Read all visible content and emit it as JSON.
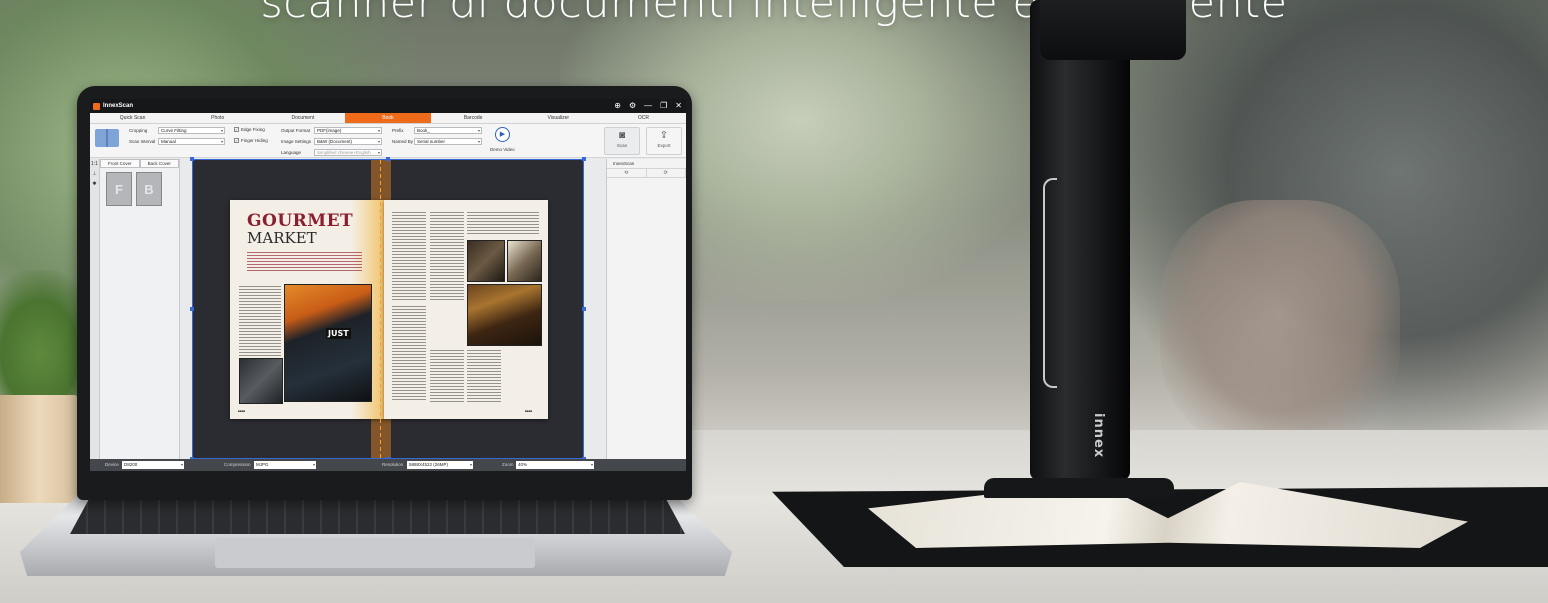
{
  "hero": {
    "title": "scanner di documenti intelligente ed efficiente"
  },
  "app": {
    "name": "InnexScan",
    "window_controls": [
      "⊕",
      "⚙",
      "—",
      "❐",
      "✕"
    ],
    "tabs": [
      {
        "label": "Quick Scan",
        "active": false
      },
      {
        "label": "Photo",
        "active": false
      },
      {
        "label": "Document",
        "active": false
      },
      {
        "label": "Book",
        "active": true
      },
      {
        "label": "Barcode",
        "active": false
      },
      {
        "label": "Visualizer",
        "active": false
      },
      {
        "label": "OCR",
        "active": false
      }
    ],
    "toolbar": {
      "cropping_label": "Cropping",
      "cropping_value": "Curve Fitting",
      "scan_interval_label": "Scan Interval",
      "scan_interval_value": "Manual",
      "edge_fixing_label": "Edge Fixing",
      "edge_fixing_checked": "✓",
      "finger_hiding_label": "Finger Hiding",
      "finger_hiding_checked": "✓",
      "output_format_label": "Output Format",
      "output_format_value": "PDF(image)",
      "image_settings_label": "Image Settings",
      "image_settings_value": "B&W (Document)",
      "language_label": "Language",
      "language_value": "Simplified chinese+English",
      "prefix_label": "Prefix",
      "prefix_value": "Book_",
      "named_by_label": "Named By",
      "named_by_value": "Serial number",
      "demo_video_label": "Demo Video",
      "scan_label": "Scan",
      "export_label": "Export"
    },
    "left_strip": {
      "ratio_label": "1:1"
    },
    "thumb_panel": {
      "front_cover_label": "Front Cover",
      "back_cover_label": "Back Cover",
      "thumb_front": "F",
      "thumb_back": "B"
    },
    "document": {
      "headline_1": "GOURMET",
      "headline_2": "MARKET",
      "sign_text": "JUST"
    },
    "right_panel": {
      "title": "InnexScan"
    },
    "statusbar": {
      "device_label": "Device",
      "device_value": "D8200",
      "compression_label": "Compression",
      "compression_value": "MJPG",
      "resolution_label": "Resolution",
      "resolution_value": "5888X4522 (26MP)",
      "zoom_label": "Zoom",
      "zoom_value": "40%"
    }
  },
  "device": {
    "brand": "innex"
  },
  "colors": {
    "accent": "#ef6b1a",
    "selection": "#3768d6",
    "headline": "#8b1e2f"
  }
}
